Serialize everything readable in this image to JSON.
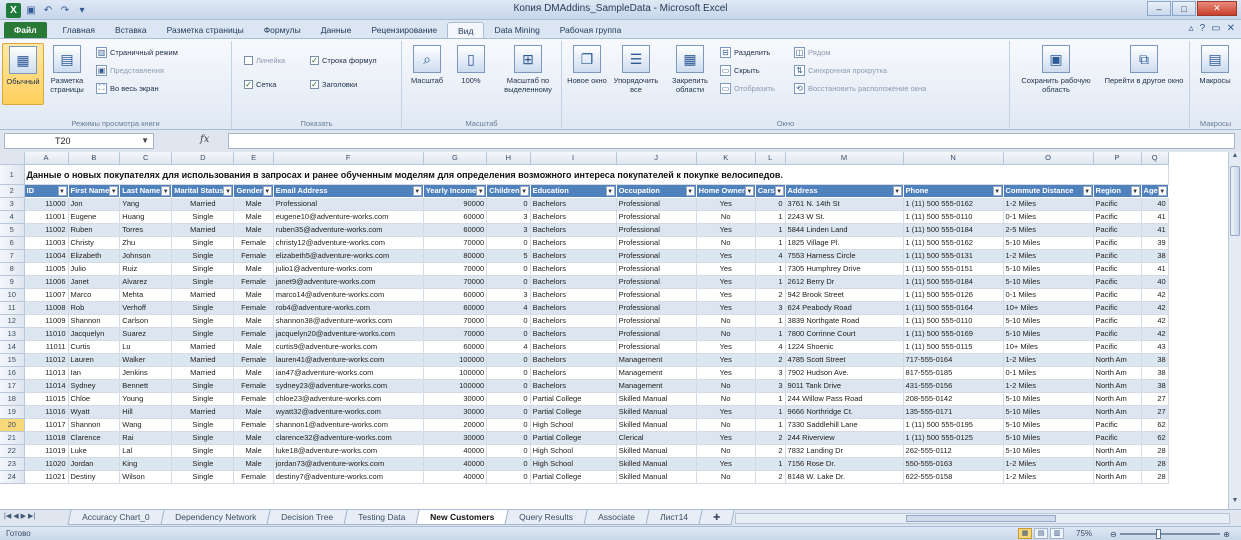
{
  "window": {
    "title": "Копия DMAddins_SampleData - Microsoft Excel",
    "controls": [
      "–",
      "□",
      "✕"
    ]
  },
  "ribbon_tabs": [
    "Файл",
    "Главная",
    "Вставка",
    "Разметка страницы",
    "Формулы",
    "Данные",
    "Рецензирование",
    "Вид",
    "Data Mining",
    "Рабочая группа"
  ],
  "active_tab": "Вид",
  "ribbon": {
    "view_modes": {
      "normal": "Обычный",
      "page_layout": "Разметка страницы",
      "page_break": "Страничный режим",
      "custom_views": "Представления",
      "full_screen": "Во весь экран",
      "label": "Режимы просмотра книги"
    },
    "show": {
      "ruler": "Линейка",
      "formula_bar": "Строка формул",
      "gridlines": "Сетка",
      "headings": "Заголовки",
      "label": "Показать"
    },
    "zoom": {
      "zoom": "Масштаб",
      "zoom100": "100%",
      "zoom_selection": "Масштаб по выделенному",
      "label": "Масштаб"
    },
    "window": {
      "new_window": "Новое окно",
      "arrange_all": "Упорядочить все",
      "freeze_panes": "Закрепить области",
      "split": "Разделить",
      "hide": "Скрыть",
      "unhide": "Отобразить",
      "side_by_side": "Рядом",
      "sync_scroll": "Синхронная прокрутка",
      "reset_position": "Восстановить расположение окна",
      "label": "Окно"
    },
    "save_workspace": "Сохранить рабочую область",
    "switch_windows": "Перейти в другое окно",
    "macros": "Макросы",
    "macros_label": "Макросы"
  },
  "formula_bar": {
    "name_box": "T20",
    "fx": "fx",
    "formula": ""
  },
  "columns": [
    "A",
    "B",
    "C",
    "D",
    "E",
    "F",
    "G",
    "H",
    "I",
    "J",
    "K",
    "L",
    "M",
    "N",
    "O",
    "P",
    "Q"
  ],
  "sheet_title": "Данные о новых покупателях для использования в запросах и ранее обученным моделям для определения возможного интереса покупателей к покупке велосипедов.",
  "headers": [
    "ID",
    "First Name",
    "Last Name",
    "Marital Status",
    "Gender",
    "Email Address",
    "Yearly Income",
    "Children",
    "Education",
    "Occupation",
    "Home Owner",
    "Cars",
    "Address",
    "Phone",
    "Commute Distance",
    "Region",
    "Age"
  ],
  "rows": [
    [
      "11000",
      "Jon",
      "Yang",
      "Married",
      "Male",
      "Professional",
      "90000",
      "0",
      "Bachelors",
      "Professional",
      "Yes",
      "0",
      "3761 N. 14th St",
      "1 (11) 500 555-0162",
      "1-2 Miles",
      "Pacific",
      "40"
    ],
    [
      "11001",
      "Eugene",
      "Huang",
      "Single",
      "Male",
      "eugene10@adventure-works.com",
      "60000",
      "3",
      "Bachelors",
      "Professional",
      "No",
      "1",
      "2243 W St.",
      "1 (11) 500 555-0110",
      "0-1 Miles",
      "Pacific",
      "41"
    ],
    [
      "11002",
      "Ruben",
      "Torres",
      "Married",
      "Male",
      "ruben35@adventure-works.com",
      "60000",
      "3",
      "Bachelors",
      "Professional",
      "Yes",
      "1",
      "5844 Linden Land",
      "1 (11) 500 555-0184",
      "2-5 Miles",
      "Pacific",
      "41"
    ],
    [
      "11003",
      "Christy",
      "Zhu",
      "Single",
      "Female",
      "christy12@adventure-works.com",
      "70000",
      "0",
      "Bachelors",
      "Professional",
      "No",
      "1",
      "1825 Village Pl.",
      "1 (11) 500 555-0162",
      "5-10 Miles",
      "Pacific",
      "39"
    ],
    [
      "11004",
      "Elizabeth",
      "Johnson",
      "Single",
      "Female",
      "elizabeth5@adventure-works.com",
      "80000",
      "5",
      "Bachelors",
      "Professional",
      "Yes",
      "4",
      "7553 Harness Circle",
      "1 (11) 500 555-0131",
      "1-2 Miles",
      "Pacific",
      "38"
    ],
    [
      "11005",
      "Julio",
      "Ruiz",
      "Single",
      "Male",
      "julio1@adventure-works.com",
      "70000",
      "0",
      "Bachelors",
      "Professional",
      "Yes",
      "1",
      "7305 Humphrey Drive",
      "1 (11) 500 555-0151",
      "5-10 Miles",
      "Pacific",
      "41"
    ],
    [
      "11006",
      "Janet",
      "Alvarez",
      "Single",
      "Female",
      "janet9@adventure-works.com",
      "70000",
      "0",
      "Bachelors",
      "Professional",
      "Yes",
      "1",
      "2612 Berry Dr",
      "1 (11) 500 555-0184",
      "5-10 Miles",
      "Pacific",
      "40"
    ],
    [
      "11007",
      "Marco",
      "Mehta",
      "Married",
      "Male",
      "marco14@adventure-works.com",
      "60000",
      "3",
      "Bachelors",
      "Professional",
      "Yes",
      "2",
      "942 Brook Street",
      "1 (11) 500 555-0126",
      "0-1 Miles",
      "Pacific",
      "42"
    ],
    [
      "11008",
      "Rob",
      "Verhoff",
      "Single",
      "Female",
      "rob4@adventure-works.com",
      "60000",
      "4",
      "Bachelors",
      "Professional",
      "Yes",
      "3",
      "624 Peabody Road",
      "1 (11) 500 555-0164",
      "10+ Miles",
      "Pacific",
      "42"
    ],
    [
      "11009",
      "Shannon",
      "Carlson",
      "Single",
      "Male",
      "shannon38@adventure-works.com",
      "70000",
      "0",
      "Bachelors",
      "Professional",
      "No",
      "1",
      "3839 Northgate Road",
      "1 (11) 500 555-0110",
      "5-10 Miles",
      "Pacific",
      "42"
    ],
    [
      "11010",
      "Jacquelyn",
      "Suarez",
      "Single",
      "Female",
      "jacquelyn20@adventure-works.com",
      "70000",
      "0",
      "Bachelors",
      "Professional",
      "No",
      "1",
      "7800 Corrinne Court",
      "1 (11) 500 555-0169",
      "5-10 Miles",
      "Pacific",
      "42"
    ],
    [
      "11011",
      "Curtis",
      "Lu",
      "Married",
      "Male",
      "curtis9@adventure-works.com",
      "60000",
      "4",
      "Bachelors",
      "Professional",
      "Yes",
      "4",
      "1224 Shoenic",
      "1 (11) 500 555-0115",
      "10+ Miles",
      "Pacific",
      "43"
    ],
    [
      "11012",
      "Lauren",
      "Walker",
      "Married",
      "Female",
      "lauren41@adventure-works.com",
      "100000",
      "0",
      "Bachelors",
      "Management",
      "Yes",
      "2",
      "4785 Scott Street",
      "717-555-0164",
      "1-2 Miles",
      "North Am",
      "38"
    ],
    [
      "11013",
      "Ian",
      "Jenkins",
      "Married",
      "Male",
      "ian47@adventure-works.com",
      "100000",
      "0",
      "Bachelors",
      "Management",
      "Yes",
      "3",
      "7902 Hudson Ave.",
      "817-555-0185",
      "0-1 Miles",
      "North Am",
      "38"
    ],
    [
      "11014",
      "Sydney",
      "Bennett",
      "Single",
      "Female",
      "sydney23@adventure-works.com",
      "100000",
      "0",
      "Bachelors",
      "Management",
      "No",
      "3",
      "9011 Tank Drive",
      "431-555-0156",
      "1-2 Miles",
      "North Am",
      "38"
    ],
    [
      "11015",
      "Chloe",
      "Young",
      "Single",
      "Female",
      "chloe23@adventure-works.com",
      "30000",
      "0",
      "Partial College",
      "Skilled Manual",
      "No",
      "1",
      "244 Willow Pass Road",
      "208-555-0142",
      "5-10 Miles",
      "North Am",
      "27"
    ],
    [
      "11016",
      "Wyatt",
      "Hill",
      "Married",
      "Male",
      "wyatt32@adventure-works.com",
      "30000",
      "0",
      "Partial College",
      "Skilled Manual",
      "Yes",
      "1",
      "9666 Northridge Ct.",
      "135-555-0171",
      "5-10 Miles",
      "North Am",
      "27"
    ],
    [
      "11017",
      "Shannon",
      "Wang",
      "Single",
      "Female",
      "shannon1@adventure-works.com",
      "20000",
      "0",
      "High School",
      "Skilled Manual",
      "No",
      "1",
      "7330 Saddlehill Lane",
      "1 (11) 500 555-0195",
      "5-10 Miles",
      "Pacific",
      "62"
    ],
    [
      "11018",
      "Clarence",
      "Rai",
      "Single",
      "Male",
      "clarence32@adventure-works.com",
      "30000",
      "0",
      "Partial College",
      "Clerical",
      "Yes",
      "2",
      "244 Riverview",
      "1 (11) 500 555-0125",
      "5-10 Miles",
      "Pacific",
      "62"
    ],
    [
      "11019",
      "Luke",
      "Lal",
      "Single",
      "Male",
      "luke18@adventure-works.com",
      "40000",
      "0",
      "High School",
      "Skilled Manual",
      "No",
      "2",
      "7832 Landing Dr",
      "262-555-0112",
      "5-10 Miles",
      "North Am",
      "28"
    ],
    [
      "11020",
      "Jordan",
      "King",
      "Single",
      "Male",
      "jordan73@adventure-works.com",
      "40000",
      "0",
      "High School",
      "Skilled Manual",
      "Yes",
      "1",
      "7156 Rose Dr.",
      "550-555-0163",
      "1-2 Miles",
      "North Am",
      "28"
    ],
    [
      "11021",
      "Destiny",
      "Wilson",
      "Single",
      "Female",
      "destiny7@adventure-works.com",
      "40000",
      "0",
      "Partial College",
      "Skilled Manual",
      "No",
      "2",
      "8148 W. Lake Dr.",
      "622-555-0158",
      "1-2 Miles",
      "North Am",
      "28"
    ]
  ],
  "active_row_number": "20",
  "sheet_tabs": [
    "Accuracy Chart_0",
    "Dependency Network",
    "Decision Tree",
    "Testing Data",
    "New Customers",
    "Query Results",
    "Associate",
    "Лист14"
  ],
  "active_sheet": "New Customers",
  "status": {
    "ready": "Готово",
    "zoom": "75%"
  }
}
